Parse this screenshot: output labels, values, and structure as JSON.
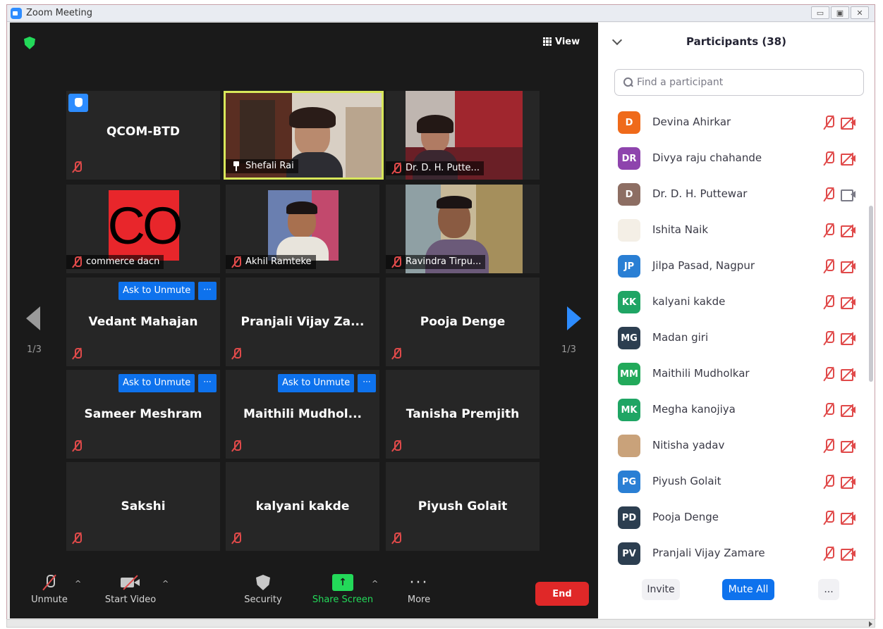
{
  "window": {
    "title": "Zoom Meeting",
    "controls": [
      "minimize-icon",
      "maximize-icon",
      "close-icon"
    ]
  },
  "meeting": {
    "view_label": "View",
    "page_indicator_left": "1/3",
    "page_indicator_right": "1/3",
    "tiles": [
      {
        "name": "QCOM-BTD",
        "hand_raised": true
      },
      {
        "name": "Shefali Rai",
        "video": true,
        "pinned": true,
        "active_speaker": true
      },
      {
        "name": "Dr. D. H. Putte...",
        "video": true
      },
      {
        "name": "commerce dacn",
        "video": true,
        "avatar_text": "CO"
      },
      {
        "name": "Akhil Ramteke",
        "video": true
      },
      {
        "name": "Ravindra Tirpu...",
        "video": true
      },
      {
        "name": "Vedant Mahajan",
        "ask_to_unmute": "Ask to Unmute"
      },
      {
        "name": "Pranjali  Vijay  Za..."
      },
      {
        "name": "Pooja Denge"
      },
      {
        "name": "Sameer Meshram",
        "ask_to_unmute": "Ask to Unmute"
      },
      {
        "name": "Maithili  Mudhol...",
        "ask_to_unmute": "Ask to Unmute"
      },
      {
        "name": "Tanisha Premjith"
      },
      {
        "name": "Sakshi"
      },
      {
        "name": "kalyani kakde"
      },
      {
        "name": "Piyush Golait"
      }
    ],
    "more_glyph": "···"
  },
  "toolbar": {
    "unmute": "Unmute",
    "start_video": "Start Video",
    "security": "Security",
    "share_screen": "Share Screen",
    "more": "More",
    "more_glyph": "···",
    "end": "End",
    "caret": "^"
  },
  "participants": {
    "title": "Participants (38)",
    "search_placeholder": "Find a participant",
    "list": [
      {
        "initials": "D",
        "name": "Devina Ahirkar",
        "color": "#ef6a1a",
        "video_on": false
      },
      {
        "initials": "DR",
        "name": "Divya raju chahande",
        "color": "#8e44ad",
        "video_on": false
      },
      {
        "initials": "D",
        "name": "Dr. D. H. Puttewar",
        "color": "#8d6e63",
        "video_on": true
      },
      {
        "initials": "",
        "name": "Ishita Naik",
        "color": "#f4efe6",
        "video_on": false
      },
      {
        "initials": "JP",
        "name": "Jilpa Pasad, Nagpur",
        "color": "#2a7fd4",
        "video_on": false
      },
      {
        "initials": "KK",
        "name": "kalyani kakde",
        "color": "#1fa564",
        "video_on": false
      },
      {
        "initials": "MG",
        "name": "Madan  giri",
        "color": "#2c3e50",
        "video_on": false
      },
      {
        "initials": "MM",
        "name": "Maithili Mudholkar",
        "color": "#22a95a",
        "video_on": false
      },
      {
        "initials": "MK",
        "name": "Megha kanojiya",
        "color": "#1fa564",
        "video_on": false
      },
      {
        "initials": "",
        "name": "Nitisha yadav",
        "color": "#c9a27a",
        "video_on": false
      },
      {
        "initials": "PG",
        "name": "Piyush Golait",
        "color": "#2a7fd4",
        "video_on": false
      },
      {
        "initials": "PD",
        "name": "Pooja Denge",
        "color": "#2c3e50",
        "video_on": false
      },
      {
        "initials": "PV",
        "name": "Pranjali Vijay Zamare",
        "color": "#2c3e50",
        "video_on": false
      }
    ],
    "footer": {
      "invite": "Invite",
      "mute_all": "Mute All",
      "more": "..."
    }
  }
}
